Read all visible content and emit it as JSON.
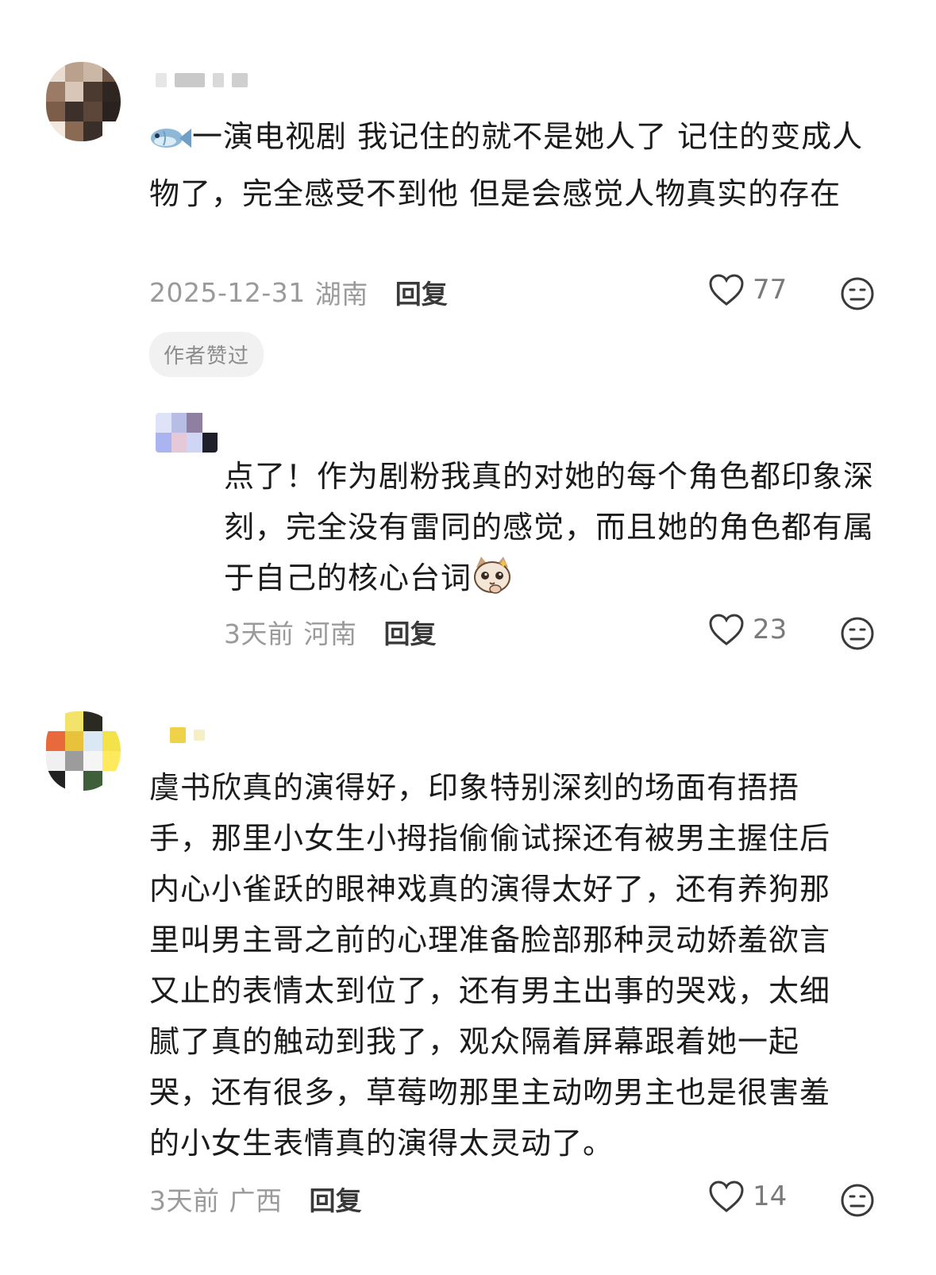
{
  "comments": [
    {
      "lead_icon": "fish-icon",
      "text": "一演电视剧 我记住的就不是她人了 记住的变成人物了，完全感受不到他 但是会感觉人物真实的存在",
      "date": "2025-12-31",
      "location": "湖南",
      "reply_label": "回复",
      "likes": "77",
      "badge": "作者赞过",
      "replies": [
        {
          "text": "点了！作为剧粉我真的对她的每个角色都印象深刻，完全没有雷同的感觉，而且她的角色都有属于自己的核心台词",
          "trail_icon": "cat-emoji-icon",
          "date": "3天前",
          "location": "河南",
          "reply_label": "回复",
          "likes": "23"
        }
      ]
    },
    {
      "text": "虞书欣真的演得好，印象特别深刻的场面有捂捂手，那里小女生小拇指偷偷试探还有被男主握住后内心小雀跃的眼神戏真的演得太好了，还有养狗那里叫男主哥之前的心理准备脸部那种灵动娇羞欲言又止的表情太到位了，还有男主出事的哭戏，太细腻了真的触动到我了，观众隔着屏幕跟着她一起哭，还有很多，草莓吻那里主动吻男主也是很害羞的小女生表情真的演得太灵动了。",
      "date": "3天前",
      "location": "广西",
      "reply_label": "回复",
      "likes": "14"
    }
  ],
  "colors": {
    "meta": "#9a9a9a",
    "text": "#1b1b1b",
    "badge_bg": "#f1f1f1"
  }
}
